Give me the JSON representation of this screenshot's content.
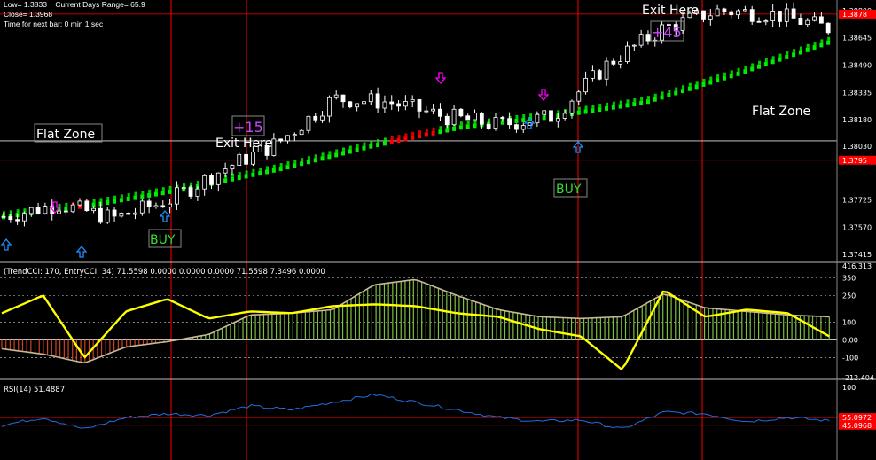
{
  "info": {
    "line1": "Low= 1.3833    Current Days Range= 65.9",
    "line2": "Close= 1.3968",
    "line3": "Time for next bar: 0 min 1 sec"
  },
  "colors": {
    "background": "#000000",
    "candle_up": "#ffffff",
    "trend_dots": "#00ee00",
    "trend_dots_red": "#ff0000",
    "arrow_up": "#1e90ff",
    "arrow_down": "#ff00ff",
    "vline": "#ff0000",
    "cci_bars": "#7fbf3f",
    "cci_bars_neg": "#cc4422",
    "cci_line": "#ffff00",
    "rsi_line": "#1e6fe0"
  },
  "chart_data": [
    {
      "type": "candlestick",
      "panel": "price",
      "ylim": [
        1.3738,
        1.3885
      ],
      "y_ticks": [
        "1.38800",
        "1.38645",
        "1.38490",
        "1.38335",
        "1.38180",
        "1.38030",
        "1.37725",
        "1.37570",
        "1.37415"
      ],
      "price_markers": [
        "1.3878",
        "1.3795"
      ],
      "annotations": {
        "flat_zone_left": "Flat Zone",
        "flat_zone_right": "Flat Zone",
        "exit_here_1": "Exit Here",
        "exit_here_2": "Exit Here",
        "gain_1": "+15",
        "gain_2": "+45",
        "buy_1": "BUY",
        "buy_2": "BUY"
      },
      "trend_line": [
        1.3763,
        1.377,
        1.3779,
        1.379,
        1.3803,
        1.3814,
        1.382,
        1.3828,
        1.3844,
        1.3862
      ],
      "close_anchors": [
        1.3763,
        1.377,
        1.3762,
        1.3772,
        1.379,
        1.3805,
        1.383,
        1.3828,
        1.382,
        1.3815,
        1.382,
        1.385,
        1.387,
        1.388,
        1.3878,
        1.387
      ]
    },
    {
      "type": "bar",
      "panel": "cci",
      "label": "(TrendCCI: 170, EntryCCI: 34)  71.5598 0.0000 0.0000 0.0000 71.5598 7.3496 0.0000",
      "ylim": [
        -212.404,
        416.313
      ],
      "y_ticks": [
        "416.313",
        "350",
        "250",
        "100",
        "0.00",
        "-100",
        "-212.404"
      ],
      "trend_cci": [
        -50,
        -80,
        -130,
        -40,
        -10,
        30,
        140,
        150,
        170,
        310,
        340,
        250,
        170,
        130,
        120,
        130,
        260,
        180,
        160,
        140,
        130
      ],
      "entry_cci": [
        150,
        250,
        -100,
        160,
        230,
        120,
        160,
        150,
        190,
        200,
        190,
        150,
        130,
        60,
        20,
        -170,
        280,
        130,
        170,
        150,
        20
      ]
    },
    {
      "type": "line",
      "panel": "rsi",
      "label": "RSI(14) 51.4887",
      "ylim": [
        0,
        100
      ],
      "y_ticks": [
        "100"
      ],
      "level_markers": [
        "55.0972",
        "45.0968"
      ],
      "values": [
        45,
        55,
        40,
        55,
        60,
        58,
        70,
        65,
        75,
        85,
        75,
        65,
        55,
        50,
        52,
        40,
        62,
        60,
        50,
        55,
        51
      ]
    }
  ]
}
